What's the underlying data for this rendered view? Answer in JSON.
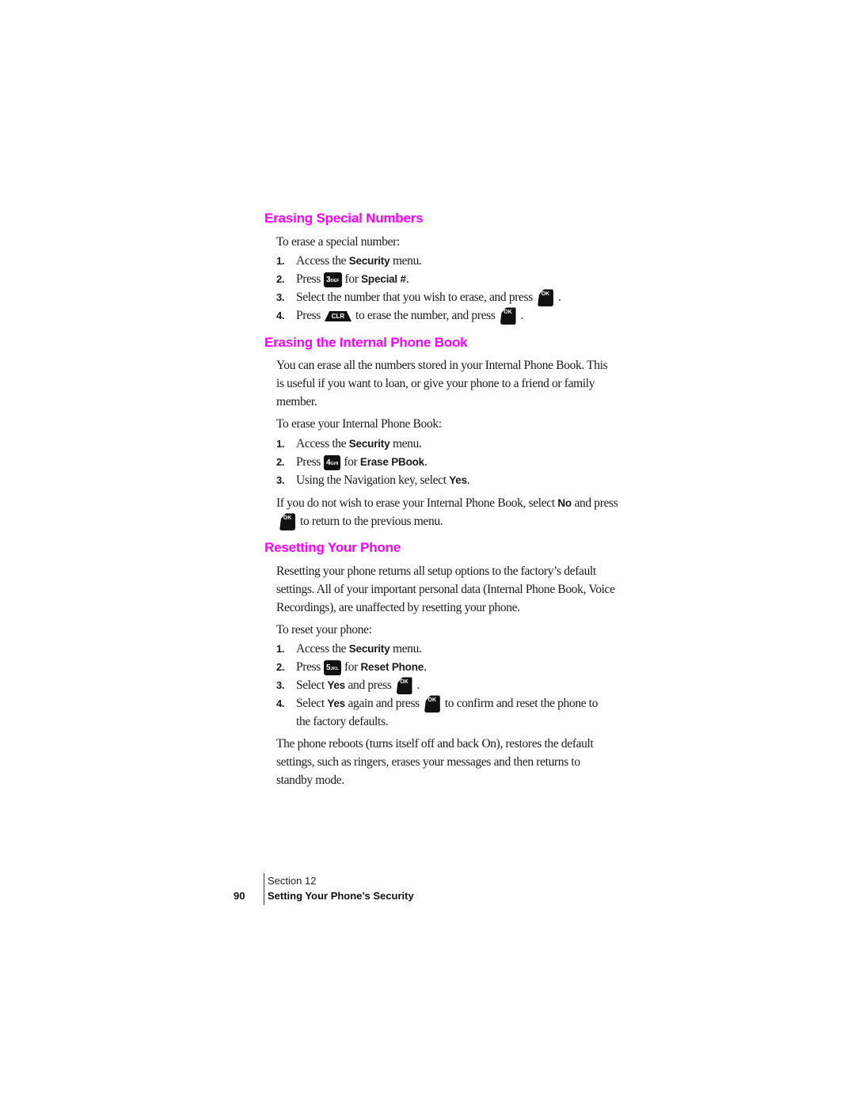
{
  "sections": [
    {
      "heading": "Erasing Special Numbers",
      "intro": "To erase a special number:",
      "steps": [
        {
          "num": "1.",
          "pre": "Access the ",
          "bold": "Security",
          "post": " menu."
        },
        {
          "num": "2.",
          "pre": "Press",
          "key_main": "3",
          "key_sub": "DEF",
          "mid": "for ",
          "bold": "Special #",
          "post": "."
        },
        {
          "num": "3.",
          "pre": "Select the number that you wish to erase, and press",
          "ok": "OK",
          "post": "."
        },
        {
          "num": "4.",
          "pre": "Press",
          "clr": "CLR",
          "mid": "to erase the number, and press",
          "ok": "OK",
          "post": "."
        }
      ]
    },
    {
      "heading": "Erasing the Internal Phone Book",
      "para_lines": [
        "You can erase all the numbers stored in your Internal Phone Book. This",
        "is useful if you want to loan, or give your phone to a friend or family",
        "member."
      ],
      "intro": "To erase your Internal Phone Book:",
      "steps": [
        {
          "num": "1.",
          "pre": "Access the ",
          "bold": "Security",
          "post": " menu."
        },
        {
          "num": "2.",
          "pre": "Press",
          "key_main": "4",
          "key_sub": "GHI",
          "mid": "for ",
          "bold": "Erase PBook",
          "post": "."
        },
        {
          "num": "3.",
          "pre": "Using the Navigation key, select ",
          "bold": "Yes",
          "post": "."
        }
      ],
      "note_pre": "If you do not wish to erase your Internal Phone Book, select ",
      "note_bold": "No",
      "note_post": " and press",
      "note_ok": "OK",
      "note_line2": "to return to the previous menu."
    },
    {
      "heading": "Resetting Your Phone",
      "para_lines": [
        "Resetting your phone returns all setup options to the factory’s default",
        "settings. All of your important personal data (Internal Phone Book, Voice",
        "Recordings), are unaffected by resetting your phone."
      ],
      "intro": "To reset your phone:",
      "steps": [
        {
          "num": "1.",
          "pre": "Access the ",
          "bold": "Security",
          "post": " menu."
        },
        {
          "num": "2.",
          "pre": "Press",
          "key_main": "5",
          "key_sub": "JKL",
          "mid": "for ",
          "bold": "Reset Phone",
          "post": "."
        },
        {
          "num": "3.",
          "pre": "Select ",
          "bold": "Yes",
          "mid": " and press",
          "ok": "OK",
          "post": "."
        },
        {
          "num": "4.",
          "pre": "Select ",
          "bold": "Yes",
          "mid": " again and press",
          "ok": "OK",
          "post": "to confirm and reset the phone to",
          "line2": "the factory defaults."
        }
      ],
      "outro_lines": [
        "The phone reboots (turns itself off and back On), restores the default",
        "settings, such as ringers, erases your messages and then returns to",
        "standby mode."
      ]
    }
  ],
  "footer": {
    "page_number": "90",
    "section_label": "Section 12",
    "section_title": "Setting Your Phone’s Security"
  },
  "colors": {
    "heading": "#ff00ff",
    "text": "#1a1a1a"
  }
}
